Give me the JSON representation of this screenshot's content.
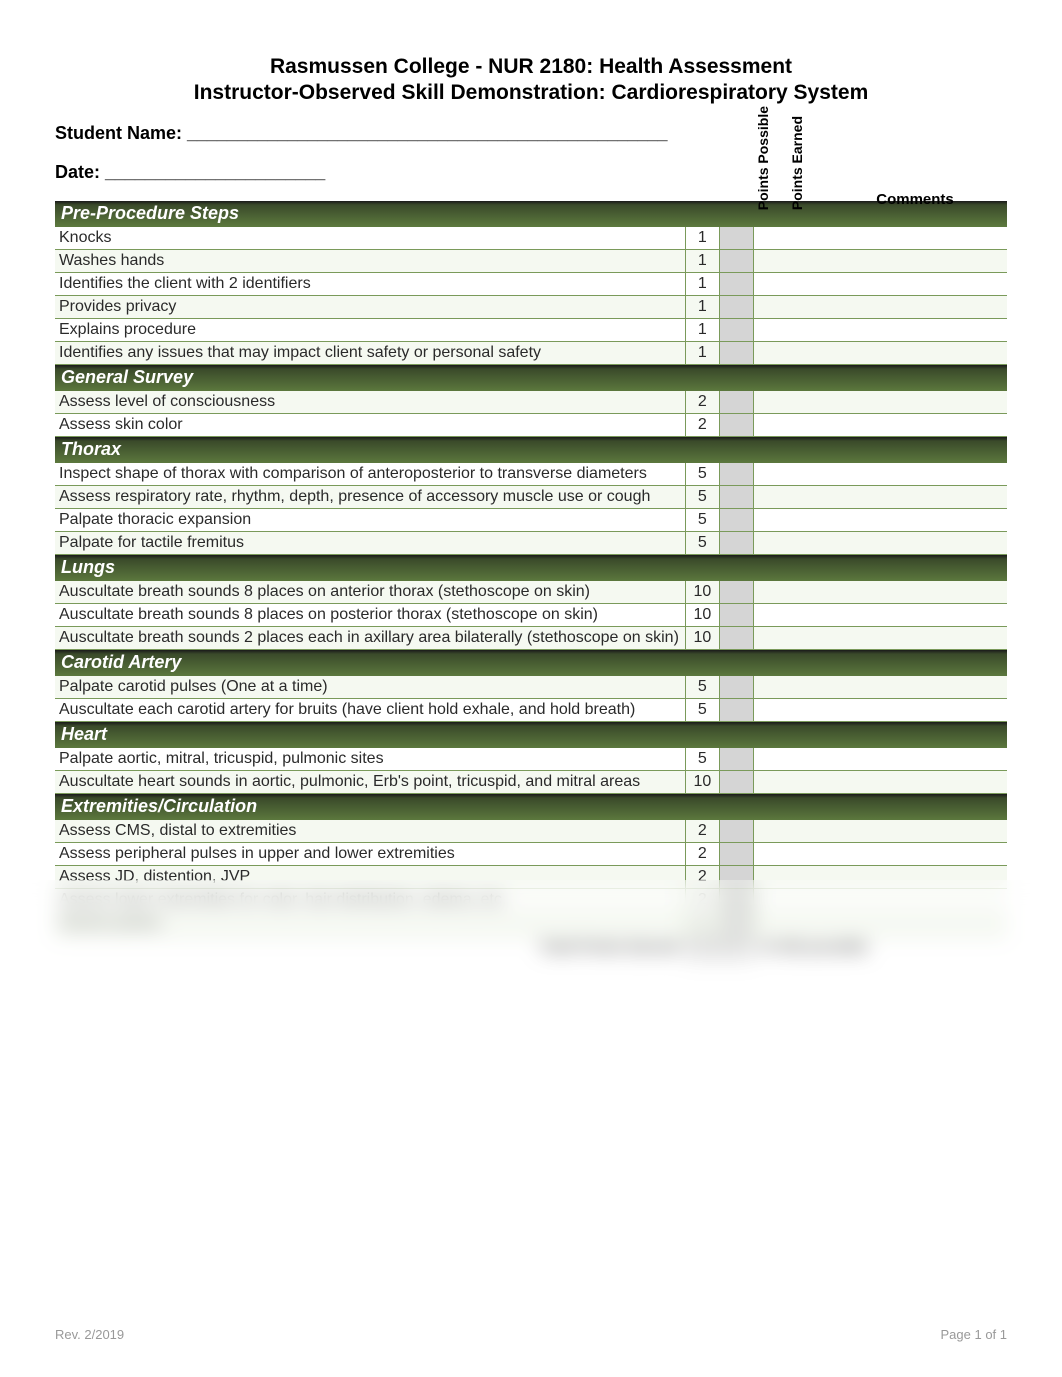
{
  "header": {
    "line1": "Rasmussen College - NUR 2180: Health Assessment",
    "line2": "Instructor-Observed Skill Demonstration: Cardiorespiratory System"
  },
  "form": {
    "student_label": "Student Name: ________________________________________________",
    "date_label": "Date: ______________________"
  },
  "columns": {
    "possible": "Points Possible",
    "earned": "Points Earned",
    "comments": "Comments"
  },
  "sections": [
    {
      "title": "Pre-Procedure Steps",
      "rows": [
        {
          "desc": "Knocks",
          "pts": "1"
        },
        {
          "desc": "Washes hands",
          "pts": "1"
        },
        {
          "desc": "Identifies the client with 2 identifiers",
          "pts": "1"
        },
        {
          "desc": "Provides privacy",
          "pts": "1"
        },
        {
          "desc": "Explains procedure",
          "pts": "1"
        },
        {
          "desc": "Identifies any issues that may impact client safety or personal safety",
          "pts": "1"
        }
      ]
    },
    {
      "title": "General Survey",
      "rows": [
        {
          "desc": "Assess level of consciousness",
          "pts": "2"
        },
        {
          "desc": "Assess skin color",
          "pts": "2"
        }
      ]
    },
    {
      "title": "Thorax",
      "rows": [
        {
          "desc": "Inspect shape of thorax with comparison of anteroposterior to transverse diameters",
          "pts": "5"
        },
        {
          "desc": "Assess respiratory rate, rhythm, depth, presence of accessory muscle use or cough",
          "pts": "5"
        },
        {
          "desc": "Palpate thoracic expansion",
          "pts": "5"
        },
        {
          "desc": "Palpate for tactile fremitus",
          "pts": "5"
        }
      ]
    },
    {
      "title": "Lungs",
      "rows": [
        {
          "desc": "Auscultate breath sounds 8 places on anterior thorax (stethoscope on skin)",
          "pts": "10"
        },
        {
          "desc": "Auscultate breath sounds 8 places on posterior thorax (stethoscope on skin)",
          "pts": "10"
        },
        {
          "desc": "Auscultate breath sounds 2 places each in axillary area bilaterally (stethoscope on skin)",
          "pts": "10"
        }
      ]
    },
    {
      "title": "Carotid Artery",
      "rows": [
        {
          "desc": "Palpate carotid pulses (One at a time)",
          "pts": "5"
        },
        {
          "desc": "Auscultate each carotid artery for bruits (have client hold exhale, and hold breath)",
          "pts": "5"
        }
      ]
    },
    {
      "title": "Heart",
      "rows": [
        {
          "desc": "Palpate aortic, mitral, tricuspid, pulmonic sites",
          "pts": "5"
        },
        {
          "desc": "Auscultate heart sounds in aortic, pulmonic, Erb's point, tricuspid, and mitral areas",
          "pts": "10"
        }
      ]
    },
    {
      "title": "Extremities/Circulation",
      "rows": [
        {
          "desc": "Assess CMS, distal to extremities",
          "pts": "2"
        },
        {
          "desc": "Assess peripheral pulses in upper and lower extremities",
          "pts": "2"
        },
        {
          "desc": "Assess JD, distention, JVP",
          "pts": "2"
        },
        {
          "desc": "Assess lower extremities for color, hair distribution, edema, etc.",
          "pts": "2"
        },
        {
          "desc": "Assess pulses",
          "pts": "2"
        }
      ]
    }
  ],
  "totals": {
    "label": "Total Points Earned",
    "suffix": "of 100 possible"
  },
  "footer": {
    "left": "Rev. 2/2019",
    "right": "Page 1 of 1"
  }
}
